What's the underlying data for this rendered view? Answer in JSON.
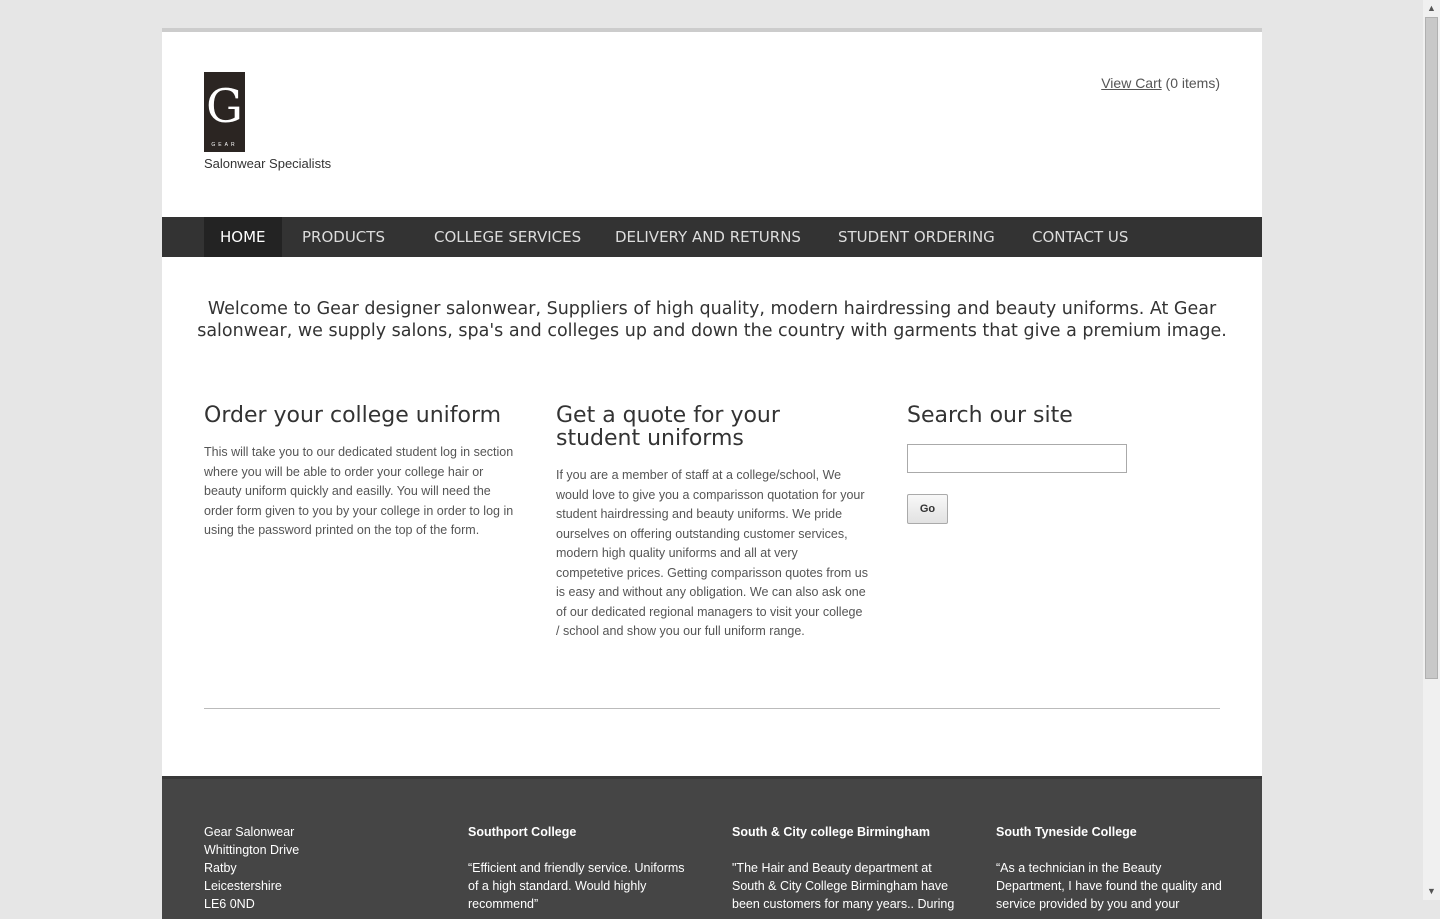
{
  "brand": {
    "logo_letter": "G",
    "logo_word": "GEAR",
    "tagline": "Salonwear Specialists"
  },
  "cart": {
    "link_label": "View Cart",
    "count_text": "(0 items)"
  },
  "nav": {
    "items": [
      {
        "label": "HOME"
      },
      {
        "label": "PRODUCTS"
      },
      {
        "label": "COLLEGE SERVICES"
      },
      {
        "label": "DELIVERY AND RETURNS"
      },
      {
        "label": "STUDENT ORDERING"
      },
      {
        "label": "CONTACT US"
      }
    ]
  },
  "welcome": "Welcome to Gear designer salonwear, Suppliers of high quality, modern hairdressing and beauty uniforms. At Gear salonwear, we supply salons, spa's and colleges up and down the country with garments that give a premium image.",
  "columns": {
    "order": {
      "heading": "Order your college uniform",
      "body": "This will take you to our dedicated student log in section where you will be able to order your college hair or beauty uniform quickly and easilly. You will need the order form given to you by your college in order to log in using the password printed on the top of the form."
    },
    "quote": {
      "heading": "Get a quote for your student uniforms",
      "body": "If you are a member of staff at a college/school, We would love to give you a comparisson quotation for your student hairdressing and beauty uniforms. We pride ourselves on offering outstanding customer services, modern high quality uniforms and all at very competetive prices. Getting comparisson quotes from us is easy and without any obligation. We can also ask one of our dedicated regional managers to visit your college / school and show you our full uniform range."
    },
    "search": {
      "heading": "Search our site",
      "input_value": "",
      "button_label": "Go"
    }
  },
  "footer": {
    "address": [
      "Gear Salonwear",
      "Whittington Drive",
      "Ratby",
      "Leicestershire",
      "LE6 0ND"
    ],
    "testimonials": [
      {
        "title": "Southport College",
        "quote": " “Efficient and friendly service. Uniforms of a high standard. Would highly recommend”"
      },
      {
        "title": "South & City college Birmingham",
        "quote": "\"The Hair and Beauty department at South & City College Birmingham have been customers for many years.. During"
      },
      {
        "title": "South Tyneside College",
        "quote": "“As a technician in the Beauty Department, I have found the quality and service provided by you and your"
      }
    ]
  },
  "colors": {
    "page_bg": "#e6e6e6",
    "nav_bg": "#333333",
    "nav_active_bg": "#232323",
    "footer_bg": "#454545",
    "text": "#333333"
  }
}
